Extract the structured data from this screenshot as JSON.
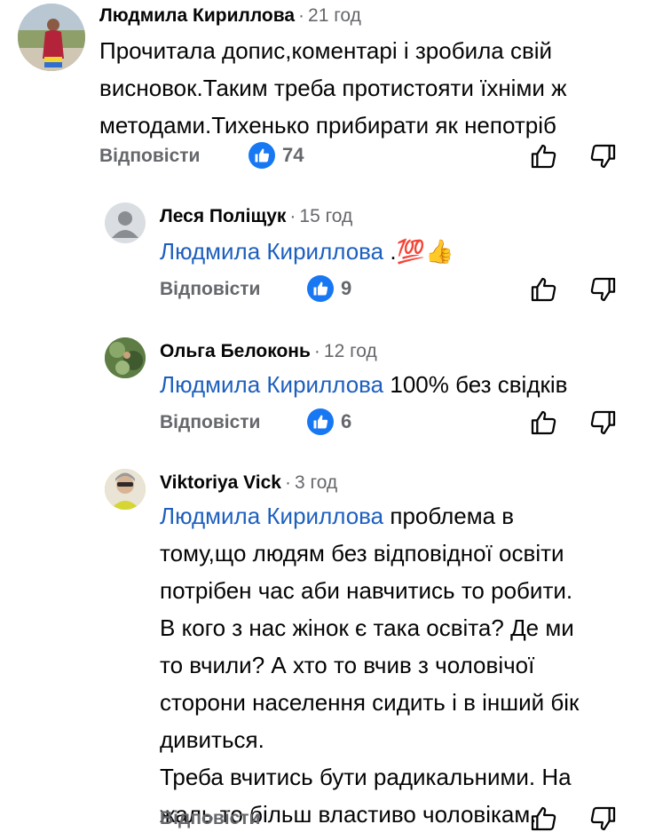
{
  "comments": [
    {
      "author": "Людмила Кириллова",
      "time": "21 год",
      "text_lines": [
        "Прочитала допис,коментарі і зробила свій",
        "висновок.Таким треба протистояти їхніми ж",
        "методами.Тихенько прибирати як непотріб"
      ],
      "reply_label": "Відповісти",
      "likes": "74",
      "avatar_icon": "profile-photo"
    },
    {
      "author": "Леся Поліщук",
      "time": "15 год",
      "mention": "Людмила Кириллова",
      "text": " .💯👍",
      "reply_label": "Відповісти",
      "likes": "9",
      "avatar_icon": "default-avatar-icon"
    },
    {
      "author": "Ольга Белоконь",
      "time": "12 год",
      "mention": "Людмила Кириллова",
      "text": " 100% без свідків",
      "reply_label": "Відповісти",
      "likes": "6",
      "avatar_icon": "profile-photo"
    },
    {
      "author": "Viktoriya Vick",
      "time": "3 год",
      "mention": "Людмила Кириллова",
      "text_first": " проблема в",
      "text_lines": [
        "тому,що людям без відповідної освіти",
        "потрібен час аби навчитись то робити.",
        "В кого з нас жінок є така освіта? Де ми",
        "то вчили? А хто то вчив з чоловічої",
        "сторони населення сидить і в інший бік",
        "дивиться.",
        "Треба вчитись бути радикальними. На",
        "жаль то більш властиво чоловікам."
      ],
      "reply_label": "Відповісти",
      "avatar_icon": "profile-photo"
    }
  ],
  "colors": {
    "like_blue": "#1877f2",
    "mention": "#1d5fbf",
    "secondary": "#65676b"
  },
  "icons": {
    "like": "thumbs-up-icon",
    "dislike": "thumbs-down-icon"
  }
}
